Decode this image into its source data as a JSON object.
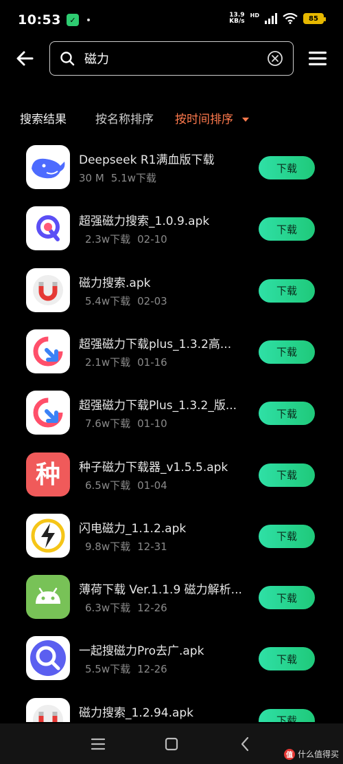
{
  "status_bar": {
    "time": "10:53",
    "net_speed_value": "13.9",
    "net_speed_unit": "KB/s",
    "battery": "85"
  },
  "search": {
    "query": "磁力"
  },
  "tabs": {
    "results": "搜索结果",
    "by_name": "按名称排序",
    "by_time": "按时间排序"
  },
  "download_label": "下载",
  "apps": [
    {
      "title": "Deepseek R1满血版下载",
      "size": "30 M",
      "downloads": "5.1w下载",
      "date": "",
      "icon": "whale-icon",
      "color": "#4d6bfe"
    },
    {
      "title": "超强磁力搜索_1.0.9.apk",
      "size": "",
      "downloads": "2.3w下载",
      "date": "02-10",
      "icon": "q-magnet-icon",
      "color": "#5b4ff5"
    },
    {
      "title": "磁力搜索.apk",
      "size": "",
      "downloads": "5.4w下载",
      "date": "02-03",
      "icon": "magnet-icon",
      "color": "#e53935"
    },
    {
      "title": "超强磁力下载plus_1.3.2高...",
      "size": "",
      "downloads": "2.1w下载",
      "date": "01-16",
      "icon": "ring-arrow-icon",
      "color": "#ff4f6a"
    },
    {
      "title": "超强磁力下载Plus_1.3.2_版...",
      "size": "",
      "downloads": "7.6w下载",
      "date": "01-10",
      "icon": "ring-arrow-icon",
      "color": "#ff4f6a"
    },
    {
      "title": "种子磁力下载器_v1.5.5.apk",
      "size": "",
      "downloads": "6.5w下载",
      "date": "01-04",
      "icon": "seed-char-icon",
      "color": "#f05a5a",
      "char": "种"
    },
    {
      "title": "闪电磁力_1.1.2.apk",
      "size": "",
      "downloads": "9.8w下载",
      "date": "12-31",
      "icon": "lightning-icon",
      "color": "#f5c518"
    },
    {
      "title": "薄荷下载 Ver.1.1.9 磁力解析...",
      "size": "",
      "downloads": "6.3w下载",
      "date": "12-26",
      "icon": "android-icon",
      "color": "#78c257"
    },
    {
      "title": "一起搜磁力Pro去广.apk",
      "size": "",
      "downloads": "5.5w下载",
      "date": "12-26",
      "icon": "magnifier-icon",
      "color": "#5b5ff0"
    },
    {
      "title": "磁力搜索_1.2.94.apk",
      "size": "",
      "downloads": "",
      "date": "",
      "icon": "magnet-icon",
      "color": "#e53935"
    }
  ],
  "watermark": {
    "badge": "值",
    "text": "什么值得买"
  }
}
